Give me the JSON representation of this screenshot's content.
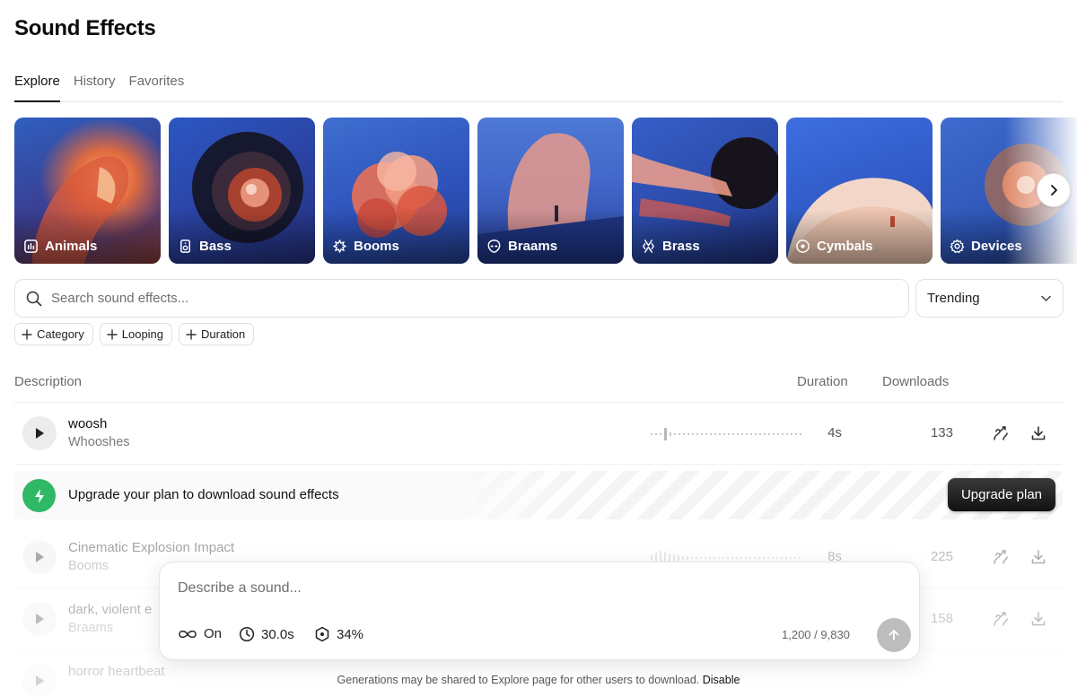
{
  "page_title": "Sound Effects",
  "tabs": [
    {
      "label": "Explore",
      "active": true
    },
    {
      "label": "History",
      "active": false
    },
    {
      "label": "Favorites",
      "active": false
    }
  ],
  "categories": [
    {
      "label": "Animals",
      "icon": "animals-icon"
    },
    {
      "label": "Bass",
      "icon": "speaker-icon"
    },
    {
      "label": "Booms",
      "icon": "burst-icon"
    },
    {
      "label": "Braams",
      "icon": "alien-icon"
    },
    {
      "label": "Brass",
      "icon": "brass-icon"
    },
    {
      "label": "Cymbals",
      "icon": "cymbal-icon"
    },
    {
      "label": "Devices",
      "icon": "gear-icon"
    }
  ],
  "search": {
    "placeholder": "Search sound effects...",
    "value": ""
  },
  "sort": {
    "selected": "Trending"
  },
  "filters": [
    "Category",
    "Looping",
    "Duration"
  ],
  "table": {
    "headers": {
      "description": "Description",
      "duration": "Duration",
      "downloads": "Downloads"
    },
    "rows": [
      {
        "title": "woosh",
        "category": "Whooshes",
        "duration": "4s",
        "downloads": "133"
      },
      {
        "title": "Cinematic Explosion Impact",
        "category": "Booms",
        "duration": "8s",
        "downloads": "225"
      },
      {
        "title": "dark, violent e",
        "category": "Braams",
        "duration": "",
        "downloads": "158"
      },
      {
        "title": "horror heartbeat",
        "category": "",
        "duration": "",
        "downloads": ""
      }
    ]
  },
  "upgrade_banner": {
    "message": "Upgrade your plan to download sound effects",
    "button": "Upgrade plan"
  },
  "composer": {
    "placeholder": "Describe a sound...",
    "loop_label": "On",
    "duration_label": "30.0s",
    "influence_label": "34%",
    "counter": "1,200 / 9,830"
  },
  "footer": {
    "text": "Generations may be shared to Explore page for other users to download.",
    "link": "Disable"
  },
  "colors": {
    "accent_green": "#2fb866",
    "primary_dark": "#111111"
  }
}
